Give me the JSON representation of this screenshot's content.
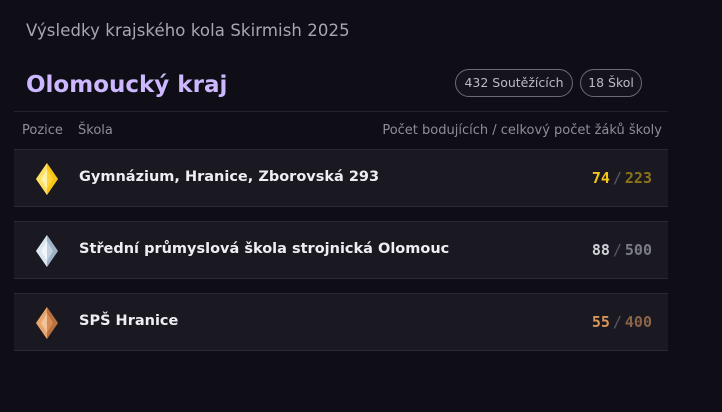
{
  "page_title": "Výsledky krajského kola Skirmish 2025",
  "region": {
    "name": "Olomoucký kraj",
    "competitors_badge": "432 Soutěžících",
    "schools_badge": "18 Škol"
  },
  "columns": {
    "position": "Pozice",
    "school": "Škola",
    "count": "Počet bodujících / celkový počet žáků školy"
  },
  "rows": [
    {
      "school": "Gymnázium, Hranice, Zborovská 293",
      "scoring": "74",
      "total": "223",
      "medal": "gold-medal-icon",
      "color": "#f5c518"
    },
    {
      "school": "Střední průmyslová škola strojnická Olomouc",
      "scoring": "88",
      "total": "500",
      "medal": "silver-medal-icon",
      "color": "#cfd1d8"
    },
    {
      "school": "SPŠ Hranice",
      "scoring": "55",
      "total": "400",
      "medal": "bronze-medal-icon",
      "color": "#d8955a"
    }
  ],
  "separator": "/"
}
